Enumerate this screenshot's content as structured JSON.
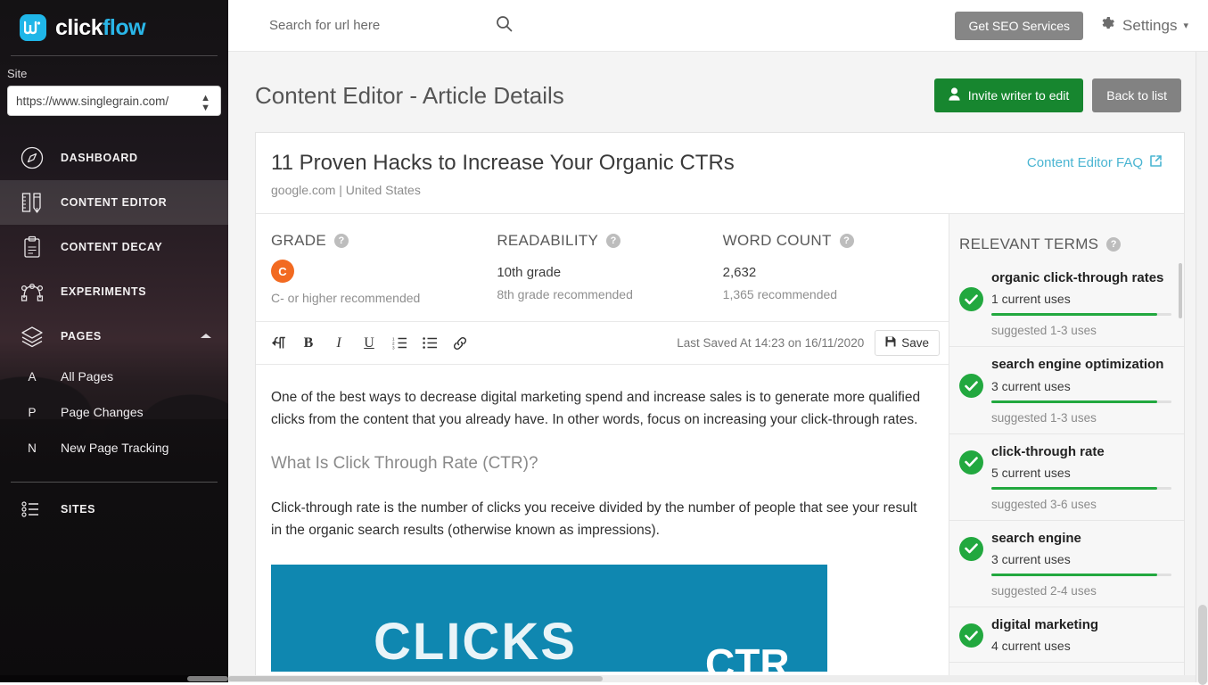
{
  "brand": {
    "part1": "click",
    "part2": "flow",
    "mark_icon": "clickflow-logo-icon"
  },
  "sidebar": {
    "site_label": "Site",
    "site_value": "https://www.singlegrain.com/",
    "nav": [
      {
        "label": "DASHBOARD",
        "icon": "compass-icon",
        "active": false
      },
      {
        "label": "CONTENT EDITOR",
        "icon": "ruler-pencil-icon",
        "active": true
      },
      {
        "label": "CONTENT DECAY",
        "icon": "clipboard-icon",
        "active": false
      },
      {
        "label": "EXPERIMENTS",
        "icon": "nodes-icon",
        "active": false
      },
      {
        "label": "PAGES",
        "icon": "layers-icon",
        "active": false,
        "expanded": true
      }
    ],
    "sub_items": [
      {
        "key": "A",
        "label": "All Pages"
      },
      {
        "key": "P",
        "label": "Page Changes"
      },
      {
        "key": "N",
        "label": "New Page Tracking"
      }
    ],
    "sites": {
      "label": "SITES",
      "icon": "sites-list-icon"
    }
  },
  "topbar": {
    "search_placeholder": "Search for url here",
    "search_value": "",
    "search_icon": "search-icon",
    "seo_button": "Get SEO Services",
    "settings_label": "Settings",
    "settings_icon": "gear-icon",
    "settings_caret": "▾"
  },
  "page": {
    "title": "Content Editor - Article Details",
    "invite_button": "Invite writer to edit",
    "invite_icon": "person-icon",
    "back_button": "Back to list"
  },
  "article": {
    "title": "11 Proven Hacks to Increase Your Organic CTRs",
    "subtitle": "google.com | United States",
    "faq_link": "Content Editor FAQ",
    "faq_icon": "external-link-icon"
  },
  "metrics": [
    {
      "label": "GRADE",
      "badge": "C",
      "badge_color": "#f26a21",
      "value": "",
      "recommended": "C- or higher recommended",
      "help_icon": "question-mark-icon"
    },
    {
      "label": "READABILITY",
      "badge": "",
      "value": "10th grade",
      "recommended": "8th grade recommended",
      "help_icon": "question-mark-icon"
    },
    {
      "label": "WORD COUNT",
      "badge": "",
      "value": "2,632",
      "recommended": "1,365 recommended",
      "help_icon": "question-mark-icon"
    }
  ],
  "toolbar": {
    "buttons": [
      {
        "name": "paragraph-direction-icon",
        "glyph": "¶"
      },
      {
        "name": "bold-icon",
        "glyph": "B"
      },
      {
        "name": "italic-icon",
        "glyph": "I"
      },
      {
        "name": "underline-icon",
        "glyph": "U"
      },
      {
        "name": "ordered-list-icon",
        "glyph": "☰"
      },
      {
        "name": "unordered-list-icon",
        "glyph": "☲"
      },
      {
        "name": "link-icon",
        "glyph": "🔗"
      }
    ],
    "last_saved": "Last Saved At 14:23 on 16/11/2020",
    "save_label": "Save",
    "save_icon": "floppy-disk-icon"
  },
  "document": {
    "paragraph1": "One of the best ways to decrease digital marketing spend and increase sales is to generate more qualified clicks from the content that you already have. In other words, focus on increasing your click-through rates.",
    "heading1": "What Is Click Through Rate (CTR)?",
    "paragraph2": "Click-through rate is the number of clicks you receive divided by the number of people that see your result in the organic search results (otherwise known as impressions).",
    "image_text1": "CLICKS",
    "image_text2": "CTR",
    "image_bg": "#0f87b0"
  },
  "relevant_terms": {
    "header": "RELEVANT TERMS",
    "help_icon": "question-mark-icon",
    "items": [
      {
        "name": "organic click-through rates",
        "uses": "1 current uses",
        "suggested": "suggested 1-3 uses",
        "bar_pct": 92,
        "status_icon": "check-circle-icon"
      },
      {
        "name": "search engine optimization",
        "uses": "3 current uses",
        "suggested": "suggested 1-3 uses",
        "bar_pct": 92,
        "status_icon": "check-circle-icon"
      },
      {
        "name": "click-through rate",
        "uses": "5 current uses",
        "suggested": "suggested 3-6 uses",
        "bar_pct": 92,
        "status_icon": "check-circle-icon"
      },
      {
        "name": "search engine",
        "uses": "3 current uses",
        "suggested": "suggested 2-4 uses",
        "bar_pct": 92,
        "status_icon": "check-circle-icon"
      },
      {
        "name": "digital marketing",
        "uses": "4 current uses",
        "suggested": "",
        "bar_pct": 92,
        "status_icon": "check-circle-icon"
      }
    ]
  },
  "colors": {
    "brand_blue": "#2ab6e8",
    "green": "#17862f",
    "check_green": "#22a83f",
    "grade_orange": "#f26a21",
    "link_blue": "#4ab5d2",
    "gray_button": "#868686"
  }
}
